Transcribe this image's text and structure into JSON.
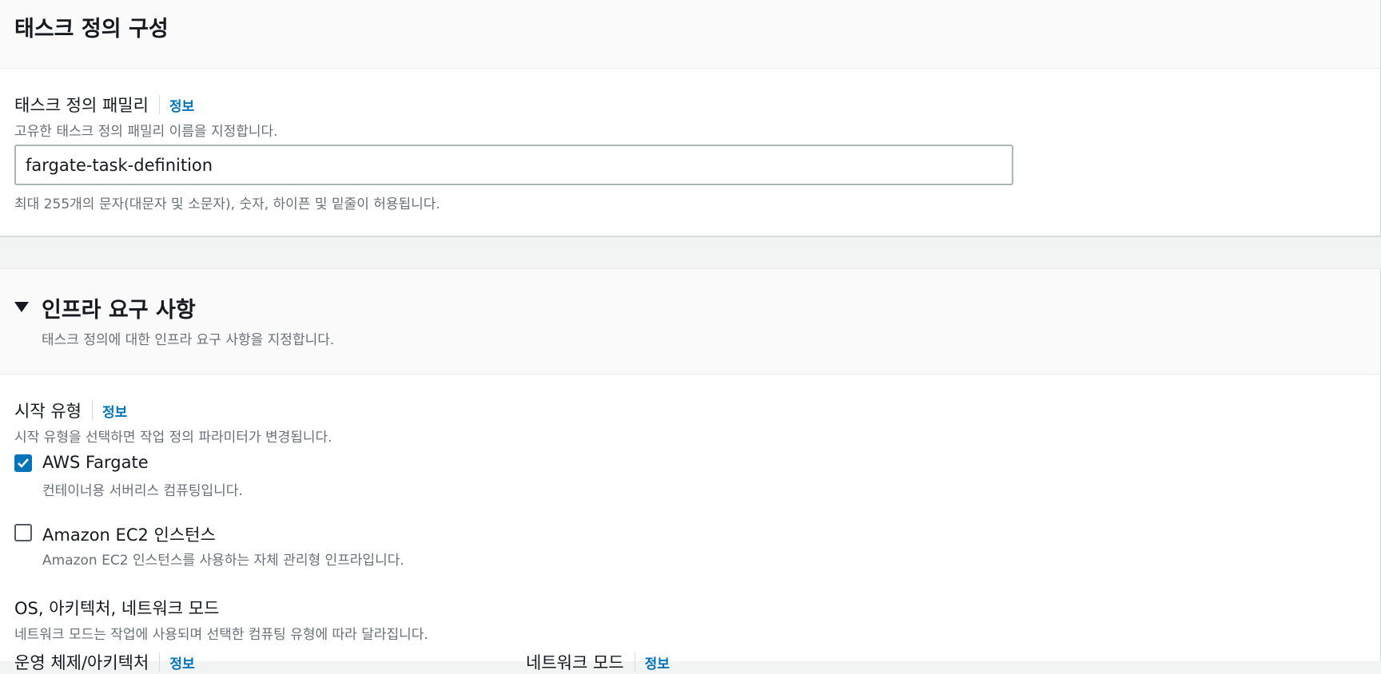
{
  "section1": {
    "title": "태스크 정의 구성",
    "family_label": "태스크 정의 패밀리",
    "info_label": "정보",
    "family_description": "고유한 태스크 정의 패밀리 이름을 지정합니다.",
    "family_value": "fargate-task-definition",
    "family_constraint": "최대 255개의 문자(대문자 및 소문자), 숫자, 하이픈 및 밑줄이 허용됩니다."
  },
  "section2": {
    "title": "인프라 요구 사항",
    "description": "태스크 정의에 대한 인프라 요구 사항을 지정합니다.",
    "launch_type_label": "시작 유형",
    "info_label": "정보",
    "launch_type_description": "시작 유형을 선택하면 작업 정의 파라미터가 변경됩니다.",
    "options": [
      {
        "label": "AWS Fargate",
        "description": "컨테이너용 서버리스 컴퓨팅입니다.",
        "checked": true
      },
      {
        "label": "Amazon EC2 인스턴스",
        "description": "Amazon EC2 인스턴스를 사용하는 자체 관리형 인프라입니다.",
        "checked": false
      }
    ],
    "os_label": "OS, 아키텍처, 네트워크 모드",
    "os_description": "네트워크 모드는 작업에 사용되며 선택한 컴퓨팅 유형에 따라 달라집니다.",
    "os_arch_label": "운영 체제/아키텍처",
    "network_mode_label": "네트워크 모드"
  },
  "colors": {
    "link": "#0073bb",
    "checkbox_checked": "#0073bb",
    "text": "#16191f",
    "secondary_text": "#687078"
  }
}
